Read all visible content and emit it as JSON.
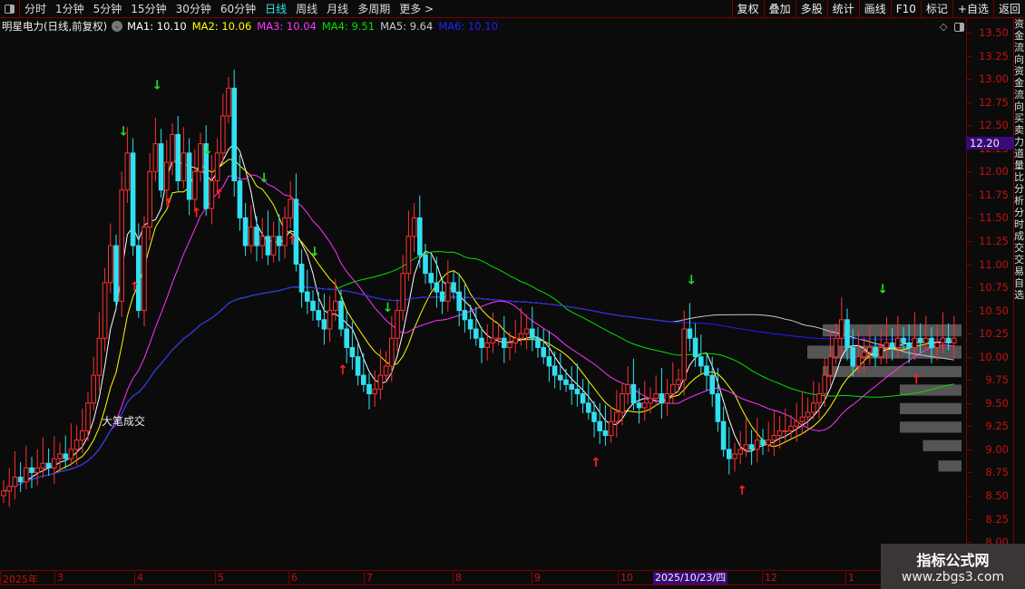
{
  "toolbar": {
    "periods": [
      "分时",
      "1分钟",
      "5分钟",
      "15分钟",
      "30分钟",
      "60分钟",
      "日线",
      "周线",
      "月线",
      "多周期",
      "更多 >"
    ],
    "active": "日线",
    "right_buttons": [
      "复权",
      "叠加",
      "多股",
      "统计",
      "画线",
      "F10",
      "标记",
      "+自选",
      "返回"
    ]
  },
  "legend": {
    "title": "明星电力(日线,前复权)",
    "ma": [
      {
        "label": "MA1: 10.10",
        "color": "#ffffff"
      },
      {
        "label": "MA2: 10.06",
        "color": "#ffff00"
      },
      {
        "label": "MA3: 10.04",
        "color": "#ff33ff"
      },
      {
        "label": "MA4: 9.51",
        "color": "#00e000"
      },
      {
        "label": "MA5: 9.64",
        "color": "#c8c8c8"
      },
      {
        "label": "MA6: 10.10",
        "color": "#2020ff"
      }
    ]
  },
  "annotation": "大笔成交",
  "current_price": "12.20",
  "date_label": "2025/10/23/四",
  "months": [
    {
      "label": "2025年"
    },
    {
      "label": "3"
    },
    {
      "label": "4"
    },
    {
      "label": "5"
    },
    {
      "label": "6"
    },
    {
      "label": "7"
    },
    {
      "label": "8"
    },
    {
      "label": "9"
    },
    {
      "label": "10"
    },
    {
      "label": "12"
    },
    {
      "label": "1"
    }
  ],
  "side_text": "资金流向资金流向买卖力道量比分析分时成交交易自选",
  "watermark": {
    "title": "指标公式网",
    "url": "www.zbgs3.com"
  },
  "chart_data": {
    "type": "candlestick",
    "ylim": [
      8.0,
      13.5
    ],
    "yticks": [
      "13.50",
      "13.25",
      "13.00",
      "12.75",
      "12.50",
      "12.25",
      "12.00",
      "11.75",
      "11.50",
      "11.25",
      "11.00",
      "10.75",
      "10.50",
      "10.25",
      "10.00",
      "9.75",
      "9.50",
      "9.25",
      "9.00",
      "8.75",
      "8.50",
      "8.25",
      "8.00"
    ],
    "closes": [
      8.55,
      8.6,
      8.7,
      8.65,
      8.8,
      8.75,
      8.8,
      8.85,
      8.8,
      8.9,
      8.95,
      8.9,
      9.0,
      9.1,
      9.2,
      9.5,
      9.8,
      10.2,
      10.8,
      11.2,
      10.6,
      11.8,
      12.2,
      11.2,
      10.5,
      11.4,
      12.0,
      12.3,
      11.8,
      12.1,
      12.4,
      11.9,
      12.2,
      11.7,
      12.0,
      12.3,
      11.6,
      11.9,
      12.2,
      12.6,
      12.9,
      11.9,
      11.5,
      11.2,
      11.4,
      11.2,
      11.3,
      11.1,
      11.3,
      11.2,
      11.5,
      11.7,
      11.0,
      10.7,
      10.6,
      10.5,
      10.4,
      10.3,
      10.5,
      10.6,
      10.3,
      10.1,
      10.0,
      9.8,
      9.7,
      9.6,
      9.65,
      9.8,
      9.9,
      10.2,
      10.5,
      10.9,
      11.3,
      11.5,
      11.1,
      10.9,
      10.8,
      10.7,
      10.6,
      10.8,
      10.7,
      10.5,
      10.4,
      10.3,
      10.2,
      10.1,
      10.15,
      10.2,
      10.2,
      10.1,
      10.15,
      10.2,
      10.25,
      10.3,
      10.2,
      10.1,
      10.0,
      9.9,
      9.8,
      9.75,
      9.7,
      9.65,
      9.6,
      9.5,
      9.4,
      9.3,
      9.2,
      9.15,
      9.3,
      9.4,
      9.6,
      9.7,
      9.5,
      9.45,
      9.5,
      9.55,
      9.6,
      9.5,
      9.6,
      9.7,
      9.75,
      10.3,
      10.2,
      10.0,
      9.9,
      9.8,
      9.6,
      9.3,
      9.0,
      8.9,
      8.95,
      9.0,
      9.05,
      9.0,
      9.1,
      9.05,
      9.1,
      9.15,
      9.2,
      9.2,
      9.25,
      9.3,
      9.35,
      9.4,
      9.5,
      9.6,
      9.8,
      10.0,
      10.2,
      10.4,
      10.1,
      9.9,
      10.0,
      10.05,
      10.1,
      10.0,
      10.1,
      10.15,
      10.1,
      10.2,
      10.15,
      10.1,
      10.2,
      10.15,
      10.2,
      10.1,
      10.15,
      10.2,
      10.15,
      10.2
    ],
    "ma_periods": [
      5,
      10,
      20,
      60,
      120,
      250
    ],
    "sell_signals": [
      21,
      27,
      36,
      46,
      55,
      68,
      122,
      156
    ],
    "buy_signals": [
      23,
      29,
      34,
      38,
      51,
      60,
      105,
      131,
      162
    ],
    "volume_profile": [
      {
        "from": 10.35,
        "to": 10.22,
        "level": 0.9
      },
      {
        "from": 10.12,
        "to": 9.98,
        "level": 1.0
      },
      {
        "from": 9.9,
        "to": 9.78,
        "level": 0.9
      },
      {
        "from": 9.7,
        "to": 9.58,
        "level": 0.4
      },
      {
        "from": 9.5,
        "to": 9.38,
        "level": 0.4
      },
      {
        "from": 9.3,
        "to": 9.18,
        "level": 0.4
      },
      {
        "from": 9.1,
        "to": 8.98,
        "level": 0.25
      },
      {
        "from": 8.88,
        "to": 8.76,
        "level": 0.15
      }
    ]
  }
}
